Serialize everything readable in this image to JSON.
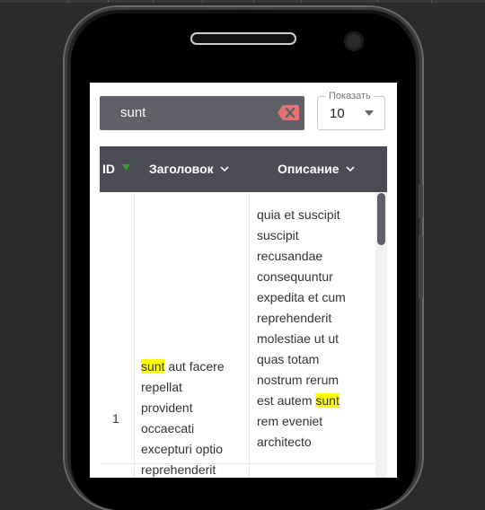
{
  "search": {
    "value": "sunt"
  },
  "page_size": {
    "label": "Показать",
    "value": "10"
  },
  "table": {
    "headers": {
      "id": "ID",
      "title": "Заголовок",
      "description": "Описание"
    },
    "row": {
      "id": "1",
      "title_highlight": "sunt",
      "title_lines": [
        " aut facere",
        "repellat",
        "provident",
        "occaecati",
        "excepturi optio",
        "reprehenderit"
      ],
      "desc_lines_before": [
        "quia et suscipit",
        "suscipit",
        "recusandae",
        "consequuntur",
        "expedita et cum",
        "reprehenderit",
        "molestiae ut ut",
        "quas totam",
        "nostrum rerum"
      ],
      "desc_highlight_prefix": "est autem ",
      "desc_highlight": "sunt",
      "desc_lines_after": [
        "rem eveniet",
        "architecto"
      ]
    }
  },
  "colors": {
    "header_bg": "#4b4c56",
    "search_bg": "#5f6068",
    "highlight": "#ffff00",
    "clear_icon": "#e57373",
    "sort_icon": "#3d9b3d"
  }
}
